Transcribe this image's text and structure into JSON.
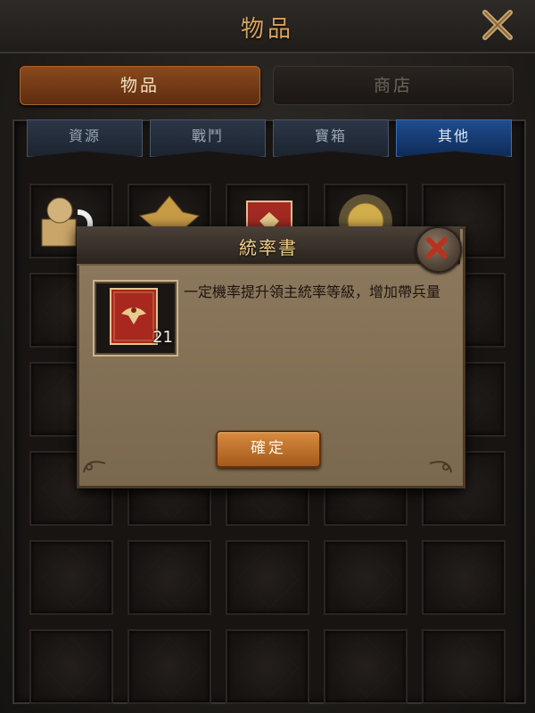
{
  "window": {
    "title": "物品"
  },
  "main_tabs": [
    {
      "label": "物品",
      "active": true
    },
    {
      "label": "商店",
      "active": false
    }
  ],
  "sub_tabs": [
    {
      "label": "資源",
      "active": false
    },
    {
      "label": "戰鬥",
      "active": false
    },
    {
      "label": "寶箱",
      "active": false
    },
    {
      "label": "其他",
      "active": true
    }
  ],
  "dialog": {
    "title": "統率書",
    "description": "一定機率提升領主統率等級，增加帶兵量",
    "item_quantity": "21",
    "confirm_label": "確定"
  },
  "icons": {
    "close": "close-icon",
    "dialog_close": "dialog-close-icon",
    "item": "red-book-icon"
  },
  "colors": {
    "title": "#d9a35b",
    "active_tab": "#8a4a1e",
    "active_subtab": "#1f4d8e",
    "dialog_bg": "#8e7a5e",
    "confirm_button": "#c8782e"
  }
}
